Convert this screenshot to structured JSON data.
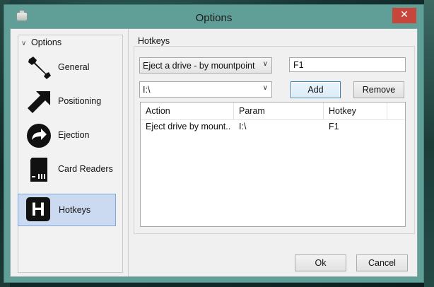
{
  "window": {
    "title": "Options",
    "close_label": "✕"
  },
  "sidebar": {
    "root_label": "Options",
    "items": [
      {
        "label": "General",
        "icon": "wrench-icon"
      },
      {
        "label": "Positioning",
        "icon": "arrow-up-right-icon"
      },
      {
        "label": "Ejection",
        "icon": "eject-arrow-icon"
      },
      {
        "label": "Card Readers",
        "icon": "sd-card-icon"
      },
      {
        "label": "Hotkeys",
        "icon": "hotkey-h-icon",
        "letter": "H",
        "selected": true
      }
    ]
  },
  "hotkeys": {
    "group_label": "Hotkeys",
    "action_select": "Eject a drive - by mountpoint",
    "key_value": "F1",
    "mount_select": "I:\\",
    "add_label": "Add",
    "remove_label": "Remove",
    "columns": [
      "Action",
      "Param",
      "Hotkey"
    ],
    "rows": [
      {
        "action": "Eject drive by mount...",
        "param": "I:\\",
        "hotkey": "F1"
      }
    ]
  },
  "footer": {
    "ok_label": "Ok",
    "cancel_label": "Cancel"
  },
  "colors": {
    "title_bar": "#5f9f98",
    "close_button": "#c7463c",
    "selected_item": "#cbdaf1"
  }
}
